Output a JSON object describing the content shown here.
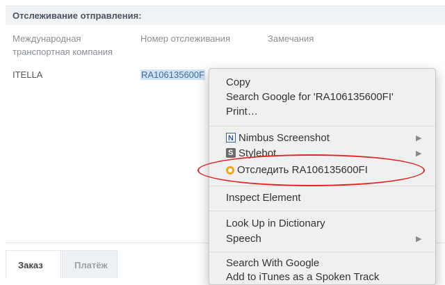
{
  "section": {
    "title": "Отслеживание отправления:"
  },
  "columns": {
    "carrier_line1": "Международная",
    "carrier_line2": "транспортная компания",
    "tracking": "Номер отслеживания",
    "remarks": "Замечания"
  },
  "row": {
    "carrier": "ITELLA",
    "tracking": "RA106135600F"
  },
  "tabs": {
    "order": "Заказ",
    "payment": "Платёж"
  },
  "menu": {
    "copy": "Copy",
    "search_google": "Search Google for 'RA106135600FI'",
    "print": "Print…",
    "nimbus": "Nimbus Screenshot",
    "stylebot": "Stylebot",
    "track": "Отследить RA106135600FI",
    "inspect": "Inspect Element",
    "lookup": "Look Up in Dictionary",
    "speech": "Speech",
    "search_with_google": "Search With Google",
    "add_itunes": "Add to iTunes as a Spoken Track"
  },
  "colors": {
    "highlight_oval": "#e02525",
    "selection": "#cfe3f7"
  }
}
